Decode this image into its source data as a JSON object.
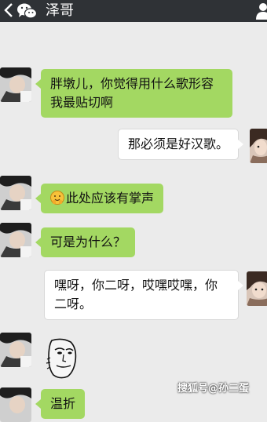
{
  "header": {
    "back_icon": "chevron-left-icon",
    "app_icon": "wechat-logo-icon",
    "title": "泽哥",
    "profile_icon": "person-icon",
    "background": "#2f3236"
  },
  "messages": [
    {
      "side": "left",
      "text_line1": "胖墩儿，你觉得用什么歌形容",
      "text_line2": "我最贴切啊"
    },
    {
      "side": "right",
      "text": "那必须是好汉歌。"
    },
    {
      "side": "left",
      "emoji": "applause-face-icon",
      "text": "此处应该有掌声"
    },
    {
      "side": "left",
      "text": "可是为什么？"
    },
    {
      "side": "right",
      "text_line1": "嘿呀，你二呀，哎嘿哎嘿，你",
      "text_line2": "二呀。"
    },
    {
      "side": "left",
      "sticker": "troll-face-sticker"
    },
    {
      "side": "left",
      "text": "温折"
    }
  ],
  "colors": {
    "sent_bubble": "#a3d862",
    "received_bubble": "#ffffff",
    "chat_background": "#ebebeb"
  },
  "watermark": "搜狐号@孙二蛋"
}
